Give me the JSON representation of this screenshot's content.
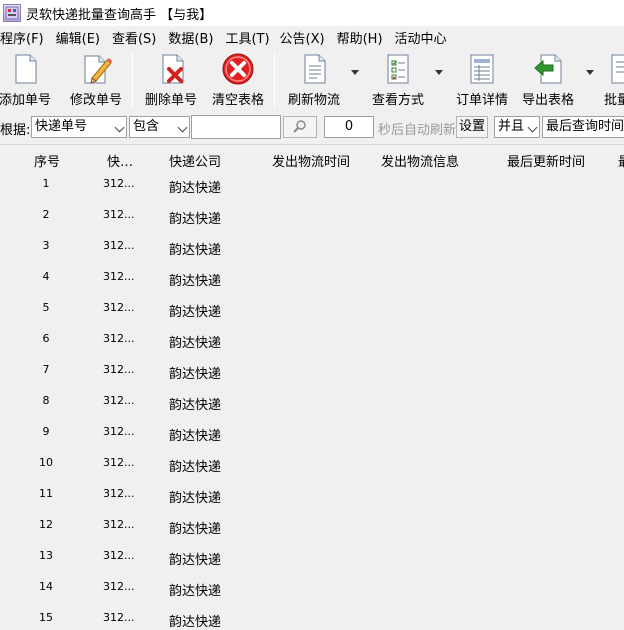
{
  "window": {
    "title": "灵软快递批量查询高手 【与我】"
  },
  "menu": [
    {
      "label": "程序(F)"
    },
    {
      "label": "编辑(E)"
    },
    {
      "label": "查看(S)"
    },
    {
      "label": "数据(B)"
    },
    {
      "label": "工具(T)"
    },
    {
      "label": "公告(X)"
    },
    {
      "label": "帮助(H)"
    },
    {
      "label": "活动中心"
    }
  ],
  "toolbar": {
    "add": "添加单号",
    "edit": "修改单号",
    "delete": "删除单号",
    "clear": "清空表格",
    "refresh": "刷新物流",
    "view_mode": "查看方式",
    "order_detail": "订单详情",
    "export": "导出表格",
    "batch": "批量"
  },
  "filter": {
    "by_label": "根据:",
    "field_value": "快递单号",
    "op_value": "包含",
    "search_value": "",
    "interval_value": "0",
    "auto_refresh_label": "秒后自动刷新",
    "set_button": "设置",
    "logic_value": "并且",
    "time_field_value": "最后查询时间"
  },
  "table": {
    "columns": [
      "序号",
      "快…",
      "快递公司",
      "发出物流时间",
      "发出物流信息",
      "最后更新时间",
      "最"
    ],
    "rows": [
      {
        "index": "1",
        "tracking": "312...",
        "company": "韵达快递"
      },
      {
        "index": "2",
        "tracking": "312...",
        "company": "韵达快递"
      },
      {
        "index": "3",
        "tracking": "312...",
        "company": "韵达快递"
      },
      {
        "index": "4",
        "tracking": "312...",
        "company": "韵达快递"
      },
      {
        "index": "5",
        "tracking": "312...",
        "company": "韵达快递"
      },
      {
        "index": "6",
        "tracking": "312...",
        "company": "韵达快递"
      },
      {
        "index": "7",
        "tracking": "312...",
        "company": "韵达快递"
      },
      {
        "index": "8",
        "tracking": "312...",
        "company": "韵达快递"
      },
      {
        "index": "9",
        "tracking": "312...",
        "company": "韵达快递"
      },
      {
        "index": "10",
        "tracking": "312...",
        "company": "韵达快递"
      },
      {
        "index": "11",
        "tracking": "312...",
        "company": "韵达快递"
      },
      {
        "index": "12",
        "tracking": "312...",
        "company": "韵达快递"
      },
      {
        "index": "13",
        "tracking": "312...",
        "company": "韵达快递"
      },
      {
        "index": "14",
        "tracking": "312...",
        "company": "韵达快递"
      },
      {
        "index": "15",
        "tracking": "312...",
        "company": "韵达快递"
      }
    ]
  },
  "icons": {
    "app": "app-icon",
    "add": "document-icon",
    "edit": "document-pencil-icon",
    "delete": "document-red-x-icon",
    "clear": "red-circle-x-icon",
    "refresh": "document-lines-icon",
    "view_mode": "checklist-icon",
    "order_detail": "list-document-icon",
    "export": "document-green-arrow-icon",
    "search": "search-icon"
  },
  "colors": {
    "background": "#f0f0f0",
    "title_bg": "#ffffff",
    "clear_red": "#e02020",
    "export_green": "#2f9a2f",
    "muted_text": "#9a9a9a"
  }
}
